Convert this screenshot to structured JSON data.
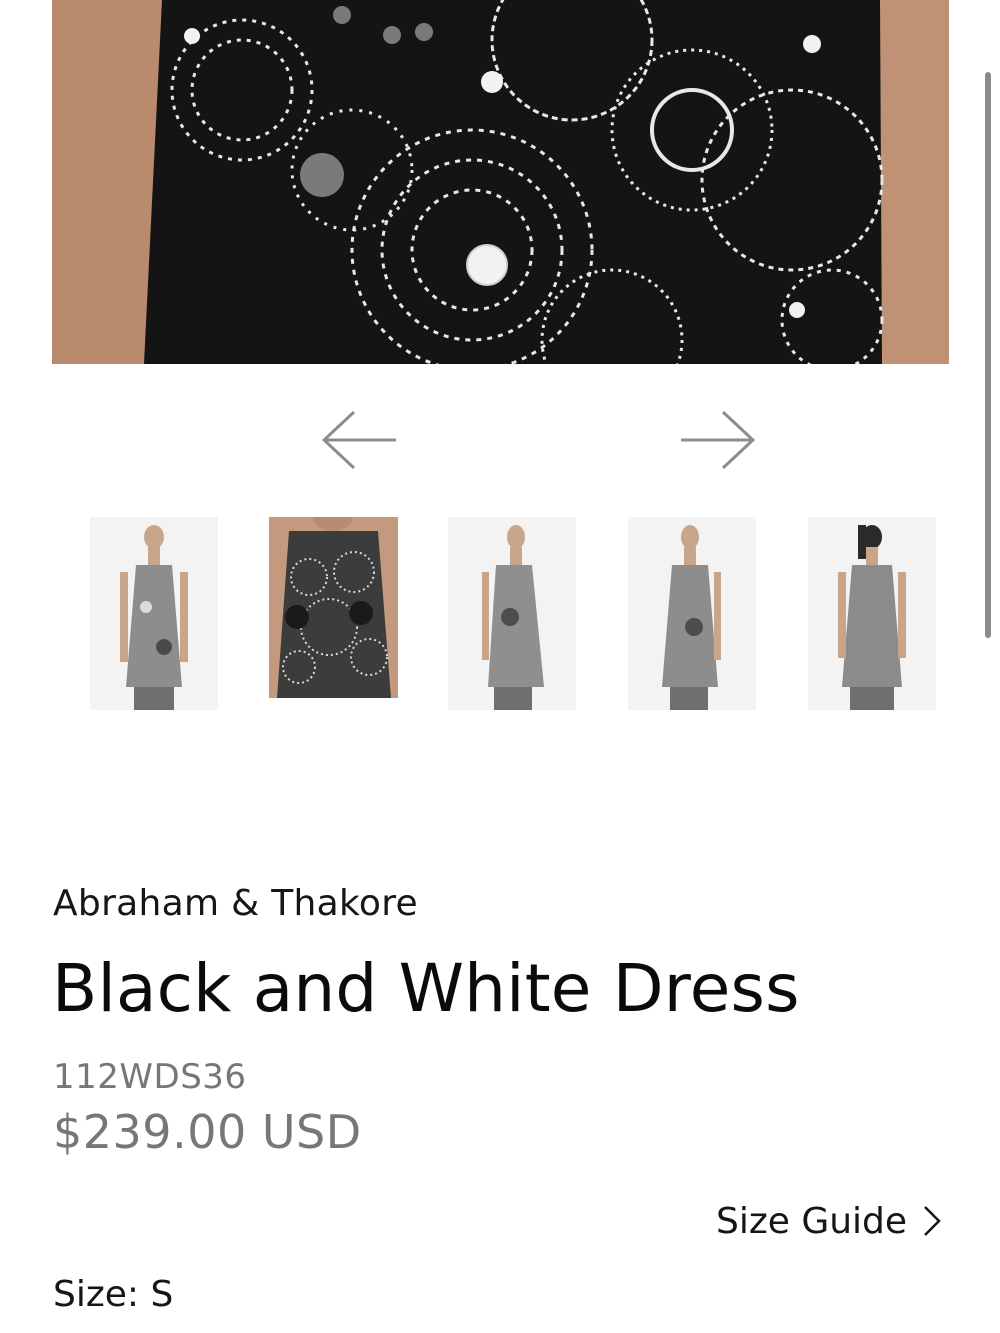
{
  "gallery": {
    "main_image_icon": "patterned-dress-photo",
    "prev_icon": "arrow-left-icon",
    "next_icon": "arrow-right-icon",
    "thumbnails": [
      {
        "icon": "dress-front-thumbnail"
      },
      {
        "icon": "dress-closeup-thumbnail"
      },
      {
        "icon": "dress-side-left-thumbnail"
      },
      {
        "icon": "dress-side-right-thumbnail"
      },
      {
        "icon": "dress-back-thumbnail"
      }
    ]
  },
  "product": {
    "brand": "Abraham & Thakore",
    "title": "Black and White Dress",
    "sku": "112WDS36",
    "price": "$239.00 USD",
    "size_guide_label": "Size Guide",
    "size_label": "Size: S"
  },
  "colors": {
    "text_dark": "#111111",
    "text_muted": "#777777",
    "arrow": "#8c8c8c"
  }
}
